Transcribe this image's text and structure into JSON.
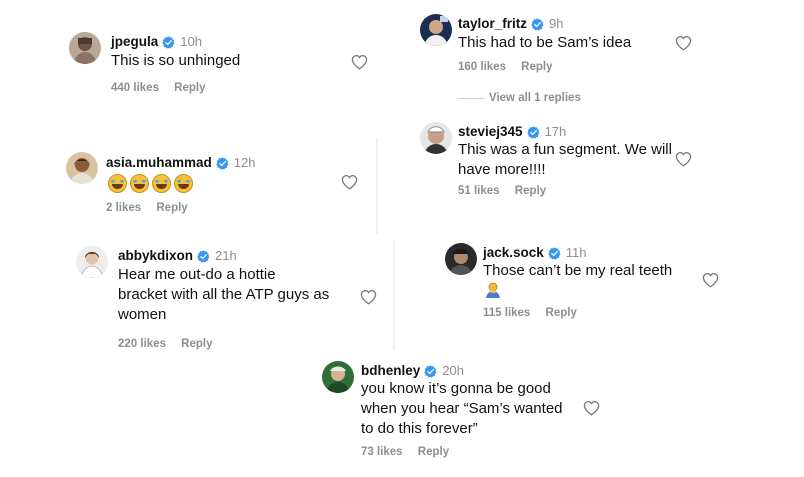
{
  "comments": [
    {
      "user": "jpegula",
      "time": "10h",
      "text": "This is so unhinged",
      "likes": "440 likes",
      "reply": "Reply"
    },
    {
      "user": "taylor_fritz",
      "time": "9h",
      "text": "This had to be Sam’s idea",
      "likes": "160 likes",
      "reply": "Reply",
      "view_replies": "View all 1 replies"
    },
    {
      "user": "steviej345",
      "time": "17h",
      "text_lines": [
        "This was a fun segment. We will",
        "have more!!!!"
      ],
      "likes": "51 likes",
      "reply": "Reply"
    },
    {
      "user": "asia.muhammad",
      "time": "12h",
      "emojis": [
        "face-with-tears-of-joy",
        "face-with-tears-of-joy",
        "face-with-tears-of-joy",
        "face-with-tears-of-joy"
      ],
      "likes": "2 likes",
      "reply": "Reply"
    },
    {
      "user": "abbykdixon",
      "time": "21h",
      "text_lines": [
        "Hear me out-do a hottie",
        "bracket with all the ATP guys as",
        "women"
      ],
      "likes": "220 likes",
      "reply": "Reply"
    },
    {
      "user": "jack.sock",
      "time": "11h",
      "text": "Those can’t be my real teeth",
      "emoji": "person-emoji",
      "likes": "115 likes",
      "reply": "Reply"
    },
    {
      "user": "bdhenley",
      "time": "20h",
      "text_lines": [
        "you know it’s gonna be good",
        "when you hear “Sam’s wanted",
        "to do this forever”"
      ],
      "likes": "73 likes",
      "reply": "Reply"
    }
  ],
  "colors": {
    "verified": "#3897f0",
    "muted": "#8e8e8e",
    "text": "#111111"
  },
  "icons": {
    "like": "heart-outline-icon",
    "verified": "verified-badge-icon"
  }
}
